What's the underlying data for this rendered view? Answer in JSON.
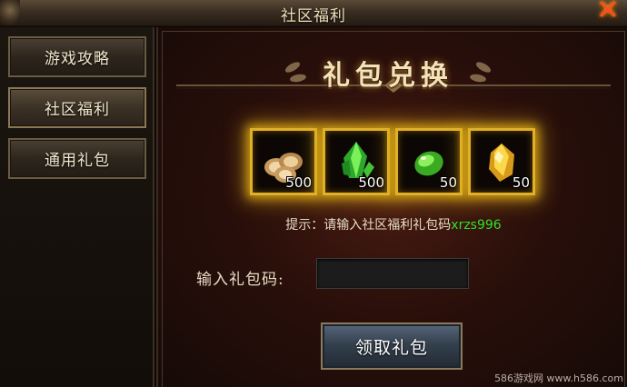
{
  "window": {
    "title": "社区福利",
    "close_icon": "close-x-icon"
  },
  "sidebar": {
    "items": [
      {
        "label": "游戏攻略"
      },
      {
        "label": "社区福利"
      },
      {
        "label": "通用礼包"
      }
    ]
  },
  "main": {
    "banner_title": "礼包兑换",
    "rewards": [
      {
        "icon": "wood-logs-icon",
        "quantity": "500",
        "color": "#d8b47a"
      },
      {
        "icon": "green-crystal-icon",
        "quantity": "500",
        "color": "#3ccc2a"
      },
      {
        "icon": "green-gem-icon",
        "quantity": "50",
        "color": "#5ad22e"
      },
      {
        "icon": "gold-gem-icon",
        "quantity": "50",
        "color": "#f2c230"
      }
    ],
    "hint_prefix": "提示：请输入社区福利礼包码",
    "hint_code": "xrzs996",
    "input_label": "输入礼包码:",
    "input_value": "",
    "redeem_button": "领取礼包"
  },
  "watermark": "586游戏网 www.h586.com",
  "colors": {
    "accent_gold": "#e0b02a",
    "hint_code": "#33e02a",
    "close": "#ff4a2a"
  }
}
